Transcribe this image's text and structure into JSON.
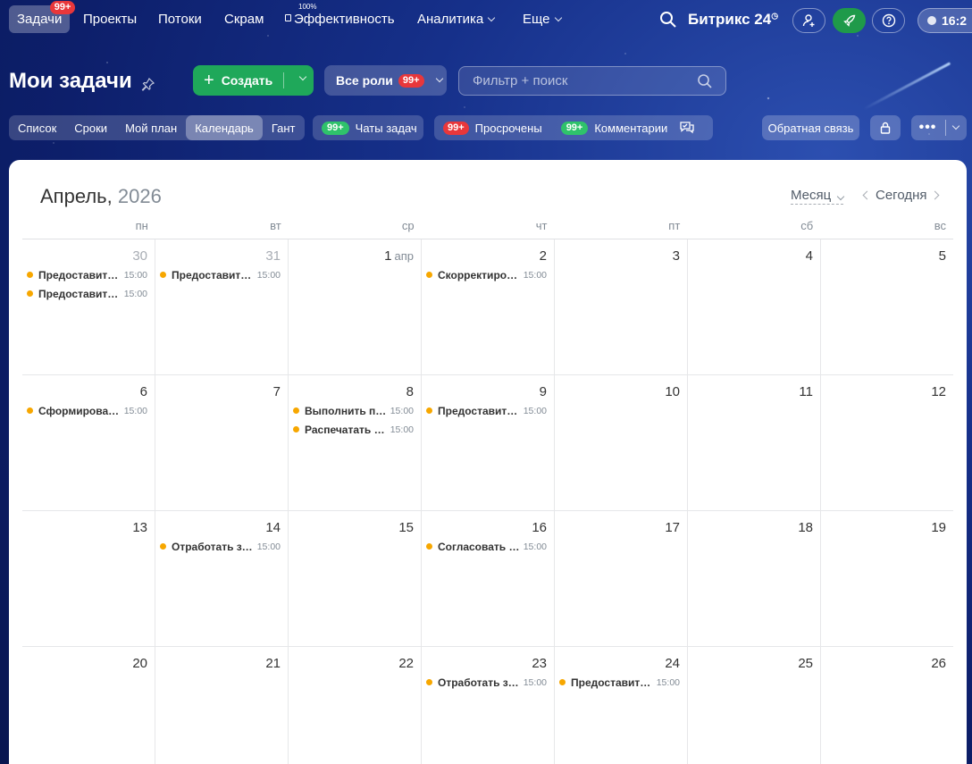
{
  "nav": {
    "items": [
      {
        "label": "Задачи",
        "badge": "99+"
      },
      {
        "label": "Проекты"
      },
      {
        "label": "Потоки"
      },
      {
        "label": "Скрам"
      },
      {
        "label": "Эффективность",
        "badge": "100%"
      },
      {
        "label": "Аналитика"
      },
      {
        "label": "Еще"
      }
    ],
    "brand": "Битрикс 24",
    "time": "16:2"
  },
  "header": {
    "title": "Мои задачи",
    "create_label": "Создать",
    "roles_label": "Все роли",
    "roles_badge": "99+",
    "search_placeholder": "Фильтр + поиск"
  },
  "views": {
    "tabs": [
      "Список",
      "Сроки",
      "Мой план",
      "Календарь",
      "Гант"
    ],
    "active": "Календарь",
    "chats_badge": "99+",
    "chats_label": "Чаты задач",
    "overdue_badge": "99+",
    "overdue_label": "Просрочены",
    "comments_badge": "99+",
    "comments_label": "Комментарии",
    "feedback_label": "Обратная связь"
  },
  "calendar": {
    "month": "Апрель,",
    "year": "2026",
    "view_mode": "Месяц",
    "today_label": "Сегодня",
    "weekdays": [
      "пн",
      "вт",
      "ср",
      "чт",
      "пт",
      "сб",
      "вс"
    ],
    "weeks": [
      [
        {
          "num": "30",
          "other": true,
          "events": [
            {
              "title": "Предоставить ...",
              "time": "15:00"
            },
            {
              "title": "Предоставить ...",
              "time": "15:00"
            }
          ]
        },
        {
          "num": "31",
          "other": true,
          "events": [
            {
              "title": "Предоставить ...",
              "time": "15:00"
            }
          ]
        },
        {
          "num": "1",
          "mon": "апр",
          "events": []
        },
        {
          "num": "2",
          "events": [
            {
              "title": "Скорректиров...",
              "time": "15:00"
            }
          ]
        },
        {
          "num": "3",
          "events": []
        },
        {
          "num": "4",
          "events": []
        },
        {
          "num": "5",
          "events": []
        }
      ],
      [
        {
          "num": "6",
          "events": [
            {
              "title": "Сформировать...",
              "time": "15:00"
            }
          ]
        },
        {
          "num": "7",
          "events": []
        },
        {
          "num": "8",
          "events": [
            {
              "title": "Выполнить пр...",
              "time": "15:00"
            },
            {
              "title": "Распечатать и ...",
              "time": "15:00"
            }
          ]
        },
        {
          "num": "9",
          "events": [
            {
              "title": "Предоставить ...",
              "time": "15:00"
            }
          ]
        },
        {
          "num": "10",
          "events": []
        },
        {
          "num": "11",
          "events": []
        },
        {
          "num": "12",
          "events": []
        }
      ],
      [
        {
          "num": "13",
          "events": []
        },
        {
          "num": "14",
          "events": [
            {
              "title": "Отработать за...",
              "time": "15:00"
            }
          ]
        },
        {
          "num": "15",
          "events": []
        },
        {
          "num": "16",
          "events": [
            {
              "title": "Согласовать с ...",
              "time": "15:00"
            }
          ]
        },
        {
          "num": "17",
          "events": []
        },
        {
          "num": "18",
          "events": []
        },
        {
          "num": "19",
          "events": []
        }
      ],
      [
        {
          "num": "20",
          "events": []
        },
        {
          "num": "21",
          "events": []
        },
        {
          "num": "22",
          "events": []
        },
        {
          "num": "23",
          "events": [
            {
              "title": "Отработать за...",
              "time": "15:00"
            }
          ]
        },
        {
          "num": "24",
          "events": [
            {
              "title": "Предоставить ...",
              "time": "15:00"
            }
          ]
        },
        {
          "num": "25",
          "events": []
        },
        {
          "num": "26",
          "events": []
        }
      ]
    ]
  },
  "colors": {
    "event_dot": "#f7a700",
    "create_button": "#1fa85a",
    "badge_red": "#e8373b",
    "badge_green": "#2fc26b"
  }
}
